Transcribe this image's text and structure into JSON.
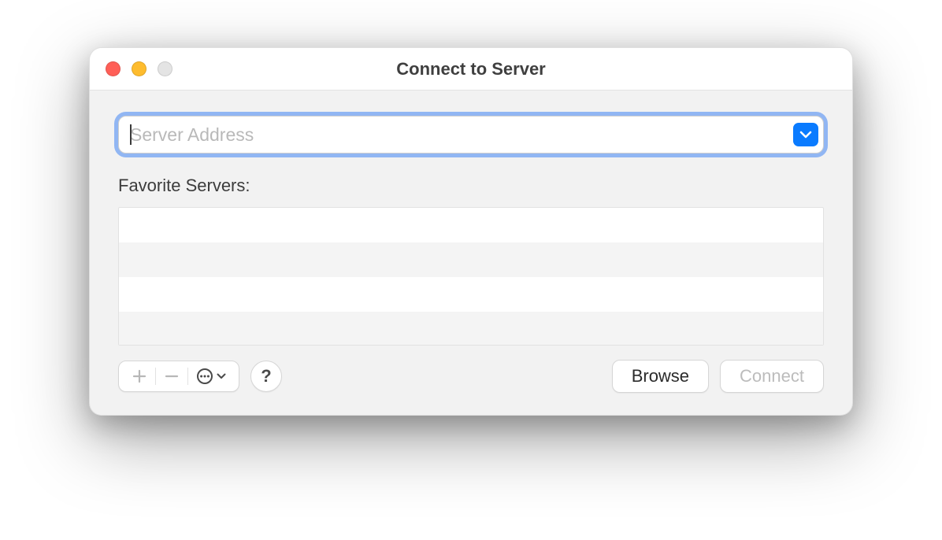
{
  "window": {
    "title": "Connect to Server"
  },
  "address": {
    "placeholder": "Server Address",
    "value": ""
  },
  "favorites": {
    "label": "Favorite Servers:"
  },
  "footer": {
    "help_label": "?",
    "browse_label": "Browse",
    "connect_label": "Connect"
  }
}
